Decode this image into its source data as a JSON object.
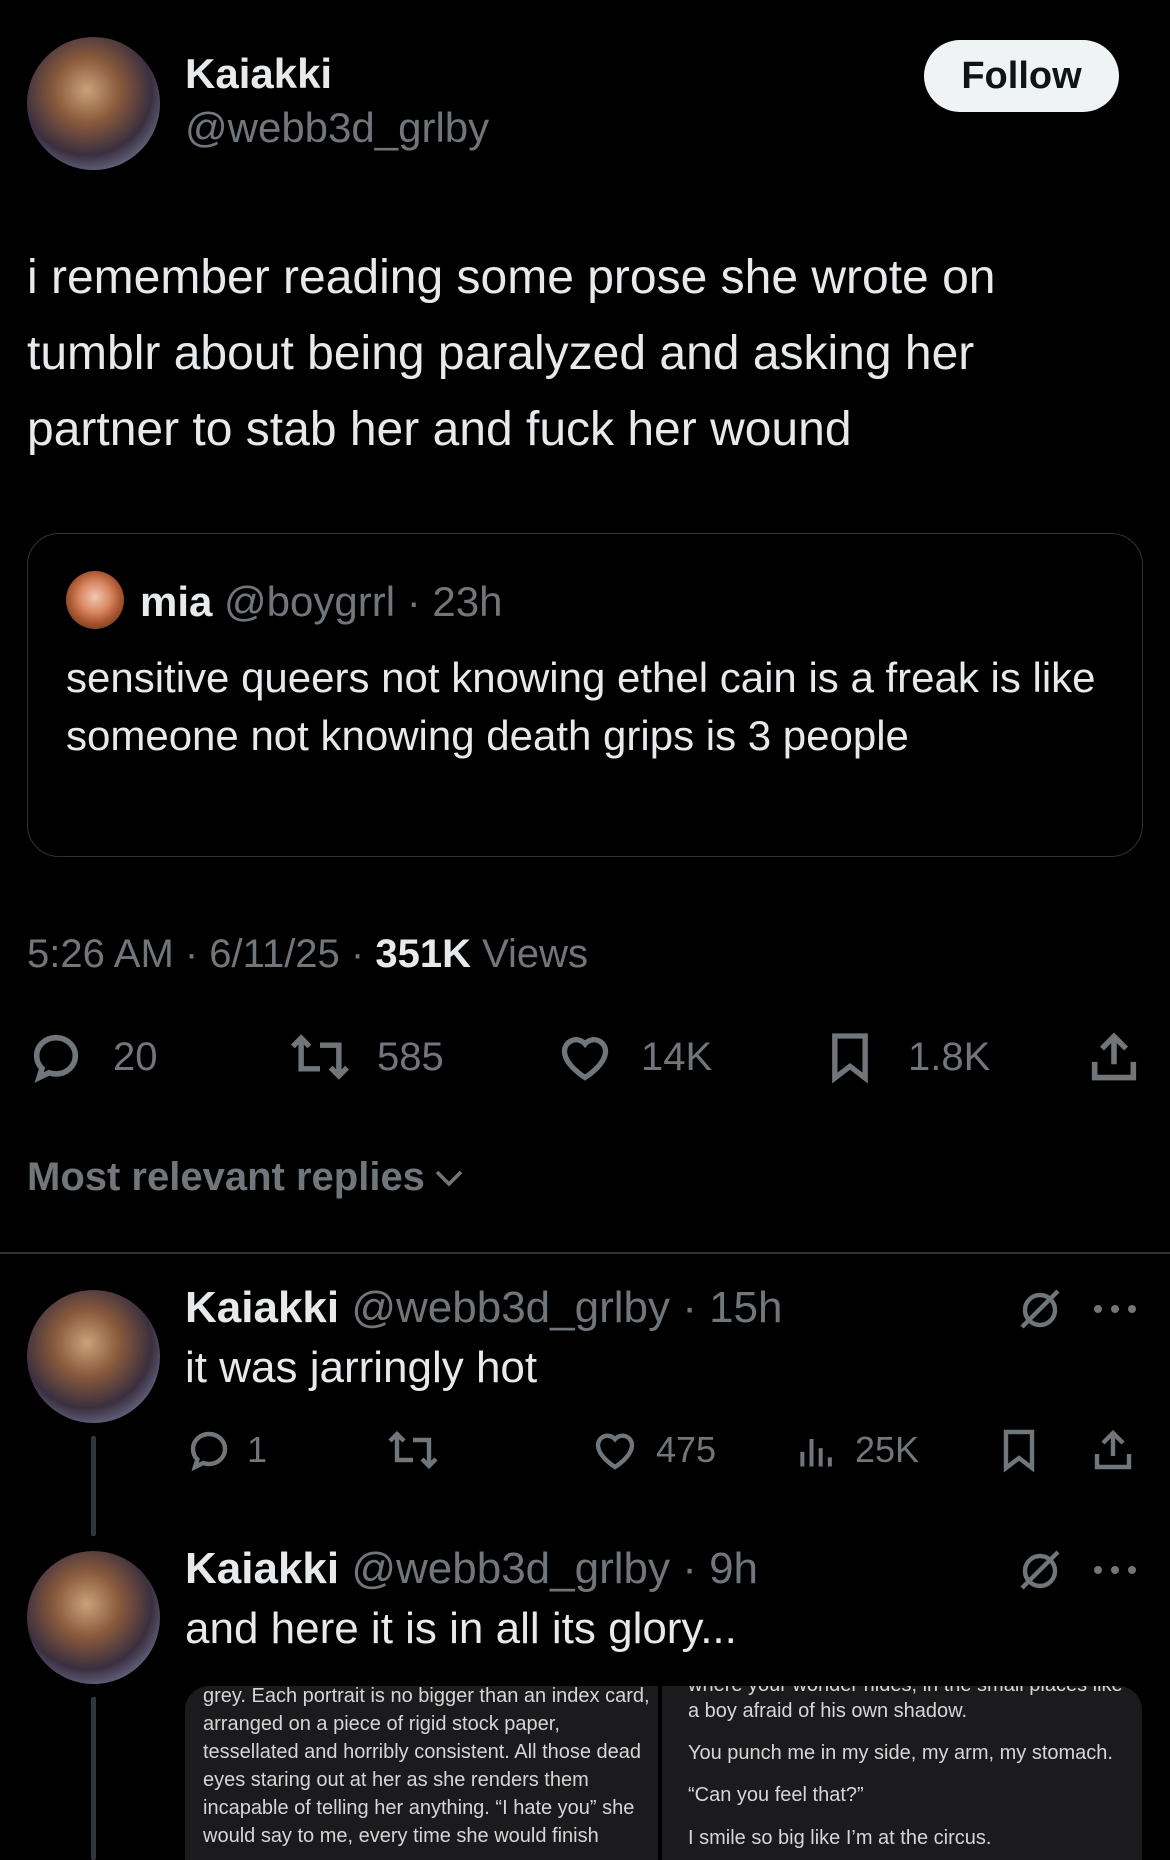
{
  "post": {
    "author_name": "Kaiakki",
    "author_handle": "@webb3d_grlby",
    "follow_label": "Follow",
    "text": "i remember reading some prose she wrote on tumblr about being paralyzed and asking her partner to stab her and fuck her wound",
    "time": "5:26 AM · 6/11/25 · ",
    "views_count": "351K",
    "views_label": " Views",
    "stats": {
      "replies": "20",
      "reposts": "585",
      "likes": "14K",
      "bookmarks": "1.8K"
    }
  },
  "quote": {
    "author_name": "mia",
    "author_handle": "@boygrrl",
    "age": " · 23h",
    "text": "sensitive queers not knowing ethel cain is a freak is like someone not knowing death grips is 3 people"
  },
  "replies_filter": {
    "label": "Most relevant replies"
  },
  "replies": [
    {
      "author_name": "Kaiakki",
      "author_handle": "@webb3d_grlby",
      "age": " · 15h",
      "text": "it was jarringly hot",
      "stats": {
        "replies": "1",
        "reposts": "",
        "likes": "475",
        "views": "25K"
      }
    },
    {
      "author_name": "Kaiakki",
      "author_handle": "@webb3d_grlby",
      "age": " · 9h",
      "text": "and here it is in all its glory...",
      "image_left_text": "grey. Each portrait is no bigger than an index card, arranged on a piece of rigid stock paper, tessellated and horribly consistent. All those dead eyes staring out at her as she renders them incapable of telling her anything. “I hate you” she would say to me, every time she would finish",
      "image_right_lines": [
        "where your wonder hides, in the small places like",
        "a boy afraid of his own shadow.",
        "You punch me in my side, my arm, my stomach.",
        "“Can you feel that?”",
        "I smile so big like I’m at the circus."
      ]
    }
  ]
}
